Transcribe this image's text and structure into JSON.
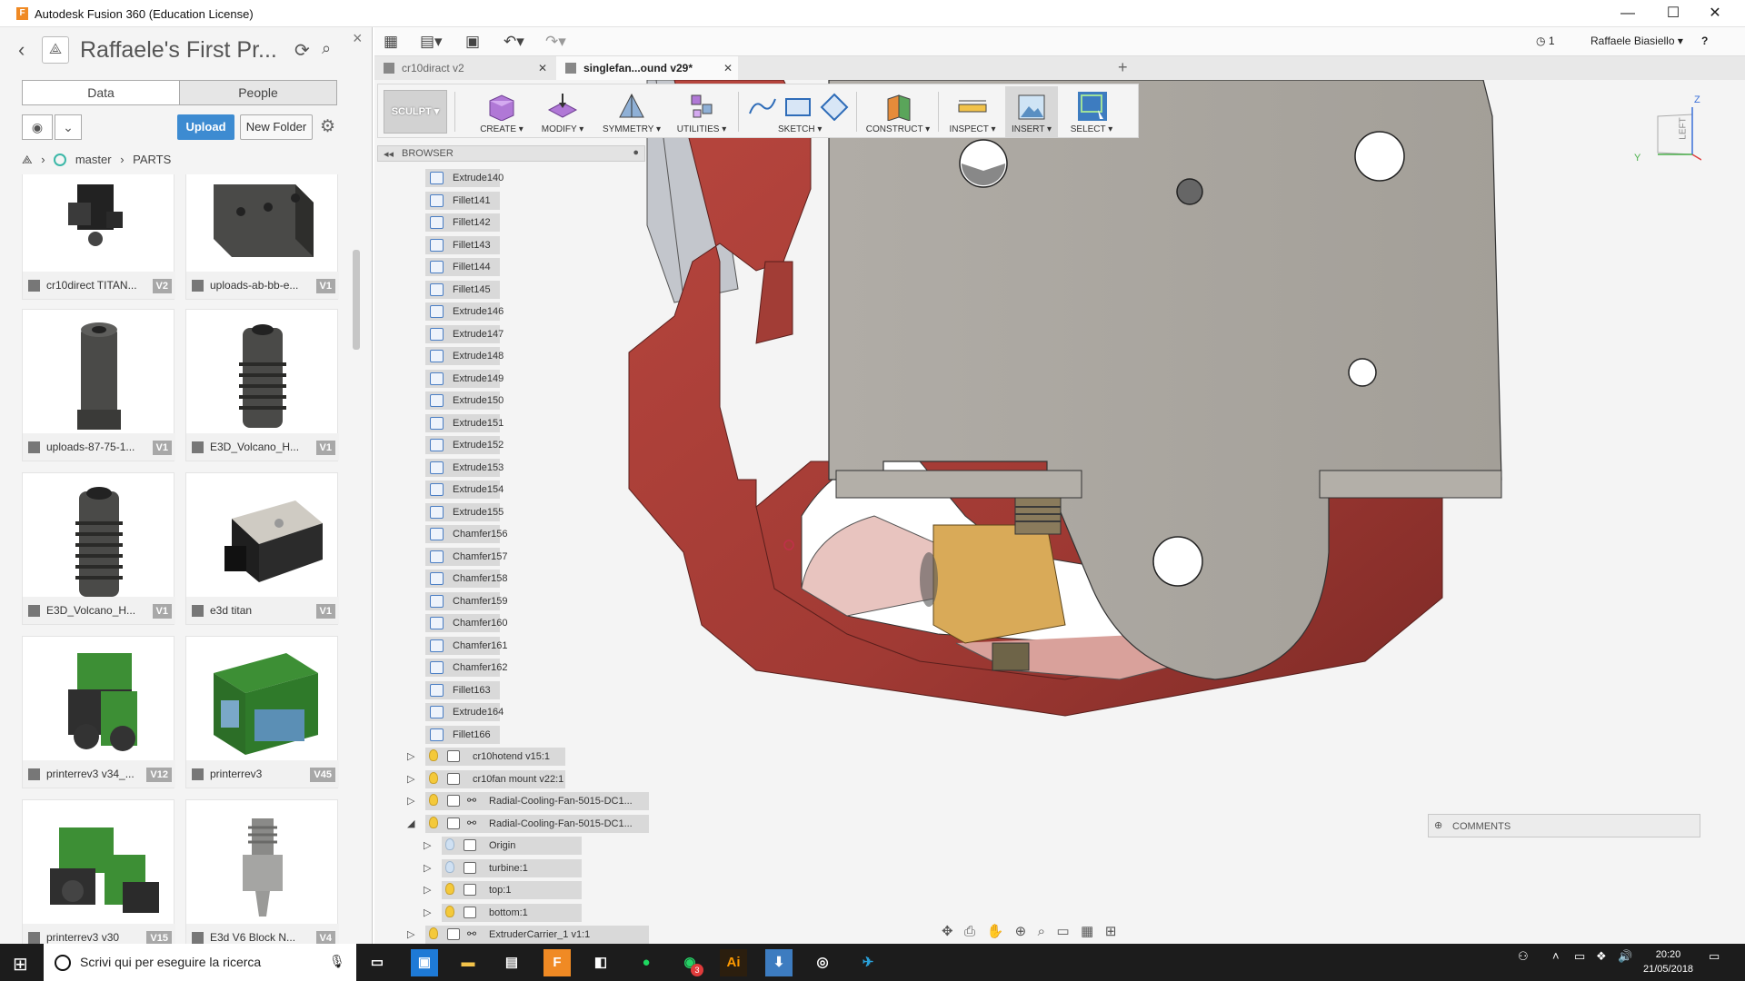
{
  "window": {
    "title": "Autodesk Fusion 360 (Education License)",
    "minimize_glyph": "—",
    "maximize_glyph": "☐",
    "close_glyph": "✕"
  },
  "data_panel": {
    "project_title": "Raffaele's First Pr...",
    "tabs": [
      "Data",
      "People"
    ],
    "active_tab": "Data",
    "upload_label": "Upload",
    "new_folder_label": "New Folder",
    "breadcrumb": {
      "branch": "master",
      "folder": "PARTS"
    },
    "items": [
      {
        "name": "cr10direct TITAN...",
        "version": "V2"
      },
      {
        "name": "uploads-ab-bb-e...",
        "version": "V1"
      },
      {
        "name": "uploads-87-75-1...",
        "version": "V1"
      },
      {
        "name": "E3D_Volcano_H...",
        "version": "V1"
      },
      {
        "name": "E3D_Volcano_H...",
        "version": "V1"
      },
      {
        "name": "e3d titan",
        "version": "V1"
      },
      {
        "name": "printerrev3 v34_...",
        "version": "V12"
      },
      {
        "name": "printerrev3",
        "version": "V45"
      },
      {
        "name": "printerrev3 v30",
        "version": "V15"
      },
      {
        "name": "E3d V6 Block N...",
        "version": "V4"
      }
    ]
  },
  "header": {
    "job_count": "1",
    "user_name": "Raffaele Biasiello ▾",
    "help": "?"
  },
  "tabs": [
    {
      "label": "cr10diract v2",
      "active": false
    },
    {
      "label": "singlefan...ound v29*",
      "active": true
    }
  ],
  "toolbar": {
    "workspace": "SCULPT ▾",
    "groups": [
      "CREATE ▾",
      "MODIFY ▾",
      "SYMMETRY ▾",
      "UTILITIES ▾",
      "SKETCH ▾",
      "CONSTRUCT ▾",
      "INSPECT ▾",
      "INSERT ▾",
      "SELECT ▾"
    ]
  },
  "browser": {
    "title": "BROWSER",
    "features": [
      "Extrude140",
      "Fillet141",
      "Fillet142",
      "Fillet143",
      "Fillet144",
      "Fillet145",
      "Extrude146",
      "Extrude147",
      "Extrude148",
      "Extrude149",
      "Extrude150",
      "Extrude151",
      "Extrude152",
      "Extrude153",
      "Extrude154",
      "Extrude155",
      "Chamfer156",
      "Chamfer157",
      "Chamfer158",
      "Chamfer159",
      "Chamfer160",
      "Chamfer161",
      "Chamfer162",
      "Fillet163",
      "Extrude164",
      "Fillet166"
    ],
    "components": [
      {
        "label": "cr10hotend v15:1",
        "indent": 0,
        "expanded": false,
        "linked": false,
        "visible": true
      },
      {
        "label": "cr10fan mount v22:1",
        "indent": 0,
        "expanded": false,
        "linked": false,
        "visible": true
      },
      {
        "label": "Radial-Cooling-Fan-5015-DC1...",
        "indent": 0,
        "expanded": false,
        "linked": true,
        "visible": true
      },
      {
        "label": "Radial-Cooling-Fan-5015-DC1...",
        "indent": 0,
        "expanded": true,
        "linked": true,
        "visible": true
      },
      {
        "label": "Origin",
        "indent": 1,
        "expanded": false,
        "linked": false,
        "visible": false
      },
      {
        "label": "turbine:1",
        "indent": 1,
        "expanded": false,
        "linked": false,
        "visible": false
      },
      {
        "label": "top:1",
        "indent": 1,
        "expanded": false,
        "linked": false,
        "visible": true
      },
      {
        "label": "bottom:1",
        "indent": 1,
        "expanded": false,
        "linked": false,
        "visible": true
      },
      {
        "label": "ExtruderCarrier_1 v1:1",
        "indent": 0,
        "expanded": false,
        "linked": true,
        "visible": true
      }
    ]
  },
  "viewcube": {
    "face": "LEFT",
    "z": "Z",
    "y": "Y"
  },
  "comments_label": "COMMENTS",
  "taskbar": {
    "search_placeholder": "Scrivi qui per eseguire la ricerca",
    "time": "20:20",
    "date": "21/05/2018",
    "whatsapp_badge": "3"
  },
  "colors": {
    "part_red": "#a8403a",
    "plate_grey": "#aaa59e",
    "heater_gold": "#d9aa58",
    "accent_blue": "#3d8bd1"
  }
}
